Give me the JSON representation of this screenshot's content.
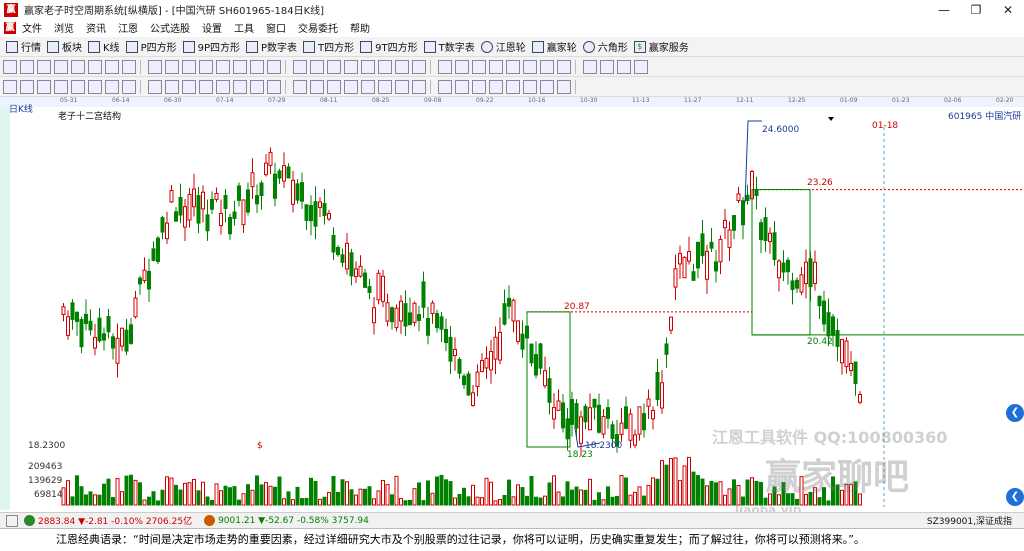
{
  "window": {
    "title": "赢家老子时空周期系统[纵横版] - [中国汽研  SH601965-184日K线]",
    "icon": "赢"
  },
  "menu": [
    "文件",
    "浏览",
    "资讯",
    "江恩",
    "公式选股",
    "设置",
    "工具",
    "窗口",
    "交易委托",
    "帮助"
  ],
  "toolbar1": [
    {
      "label": "行情",
      "icon": "grid-icon"
    },
    {
      "label": "板块",
      "icon": "blocks-icon"
    },
    {
      "label": "K线",
      "icon": "kline-icon"
    },
    {
      "label": "P四方形",
      "icon": "p-square-icon"
    },
    {
      "label": "9P四方形",
      "icon": "9p-square-icon"
    },
    {
      "label": "P数字表",
      "icon": "p-table-icon"
    },
    {
      "label": "T四方形",
      "icon": "t-square-icon"
    },
    {
      "label": "9T四方形",
      "icon": "9t-square-icon"
    },
    {
      "label": "T数字表",
      "icon": "t-table-icon"
    },
    {
      "label": "江恩轮",
      "icon": "gann-wheel-icon"
    },
    {
      "label": "赢家轮",
      "icon": "winner-wheel-icon"
    },
    {
      "label": "六角形",
      "icon": "hexagon-icon"
    },
    {
      "label": "赢家服务",
      "icon": "service-icon"
    }
  ],
  "chart": {
    "period_label": "日K线",
    "subtitle": "老子十二宫结构",
    "symbol_label": "601965 中国汽研",
    "date_marker": "01-18",
    "price_labels": {
      "high": "24.6000",
      "level_23": "23.26",
      "level_20_87": "20.87",
      "level_20_42": "20.42",
      "low": "18.2300",
      "low_box": "18.23",
      "left_axis": "18.2300",
      "dollar": "$"
    },
    "volume_axis": [
      "209463",
      "139629",
      "69814"
    ],
    "date_ticks": [
      "05-31",
      "06-14",
      "06-30",
      "07-14",
      "07-29",
      "08-11",
      "08-25",
      "09-08",
      "09-22",
      "10-16",
      "10-30",
      "11-13",
      "11-27",
      "12-11",
      "12-25",
      "01-09",
      "01-23",
      "02-06",
      "02-20"
    ],
    "watermarks": {
      "software": "江恩工具软件  QQ:100800360",
      "brand": "赢家聊吧",
      "url": "liaoba.vip"
    }
  },
  "chart_data": {
    "type": "candlestick",
    "title": "老子十二宫结构",
    "symbol": "601965 中国汽研",
    "period": "日K线",
    "ylim": [
      18.2,
      24.6
    ],
    "annotations": {
      "high": 24.6,
      "low": 18.23,
      "levels": [
        23.26,
        20.87,
        20.42
      ]
    }
  },
  "status": {
    "index1": "2883.84 ▼-2.81 -0.10% 2706.25亿",
    "index2": "9001.21 ▼-52.67 -0.58% 3757.94",
    "right": "SZ399001,深证成指"
  },
  "quote": "江恩经典语录：“时间是决定市场走势的重要因素，经过详细研究大市及个别股票的过往记录，你将可以证明，历史确实重复发生；而了解过往，你将可以预测将来。”。",
  "colors": {
    "up": "#d10000",
    "down": "#008000",
    "level_red": "#d10000",
    "level_green": "#008000",
    "high_blue": "#1a3c9a"
  }
}
